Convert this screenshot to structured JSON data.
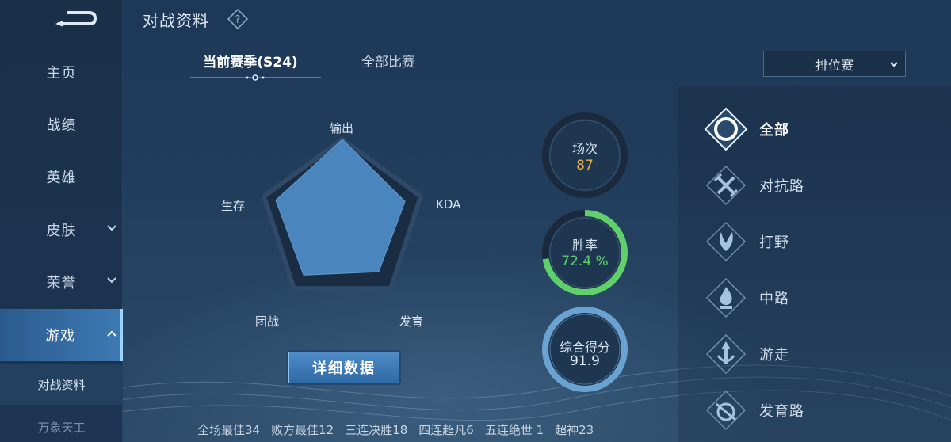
{
  "sidebar": {
    "items": [
      {
        "label": "主页"
      },
      {
        "label": "战绩"
      },
      {
        "label": "英雄"
      },
      {
        "label": "皮肤"
      },
      {
        "label": "荣誉"
      },
      {
        "label": "游戏"
      }
    ],
    "subitems": [
      {
        "label": "对战资料"
      },
      {
        "label": "万象天工"
      }
    ]
  },
  "header": {
    "title": "对战资料",
    "tabs": [
      {
        "label": "当前赛季(S24)"
      },
      {
        "label": "全部比赛"
      }
    ],
    "mode_select": {
      "value": "排位赛"
    }
  },
  "radar": {
    "axes": [
      "输出",
      "KDA",
      "发育",
      "团战",
      "生存"
    ],
    "values": [
      1.0,
      0.8,
      0.75,
      0.8,
      0.85
    ]
  },
  "detail_button": {
    "label": "详细数据"
  },
  "rings": {
    "matches": {
      "label": "场次",
      "value": "87"
    },
    "winrate": {
      "label": "胜率",
      "value": "72.4 %",
      "fraction": 0.724
    },
    "score": {
      "label": "综合得分",
      "value": "91.9"
    }
  },
  "colors": {
    "accent": "#3d79b3",
    "gold": "#e8b04a",
    "green": "#5fd06a"
  },
  "lanes": [
    {
      "label": "全部",
      "icon": "all-lanes-icon"
    },
    {
      "label": "对抗路",
      "icon": "clash-lane-icon"
    },
    {
      "label": "打野",
      "icon": "jungle-icon"
    },
    {
      "label": "中路",
      "icon": "mid-lane-icon"
    },
    {
      "label": "游走",
      "icon": "roam-icon"
    },
    {
      "label": "发育路",
      "icon": "farm-lane-icon"
    }
  ],
  "stats": [
    {
      "text": "全场最佳34"
    },
    {
      "text": "败方最佳12"
    },
    {
      "text": "三连决胜18"
    },
    {
      "text": "四连超凡6"
    },
    {
      "text": "五连绝世 1"
    },
    {
      "text": "超神23"
    }
  ]
}
